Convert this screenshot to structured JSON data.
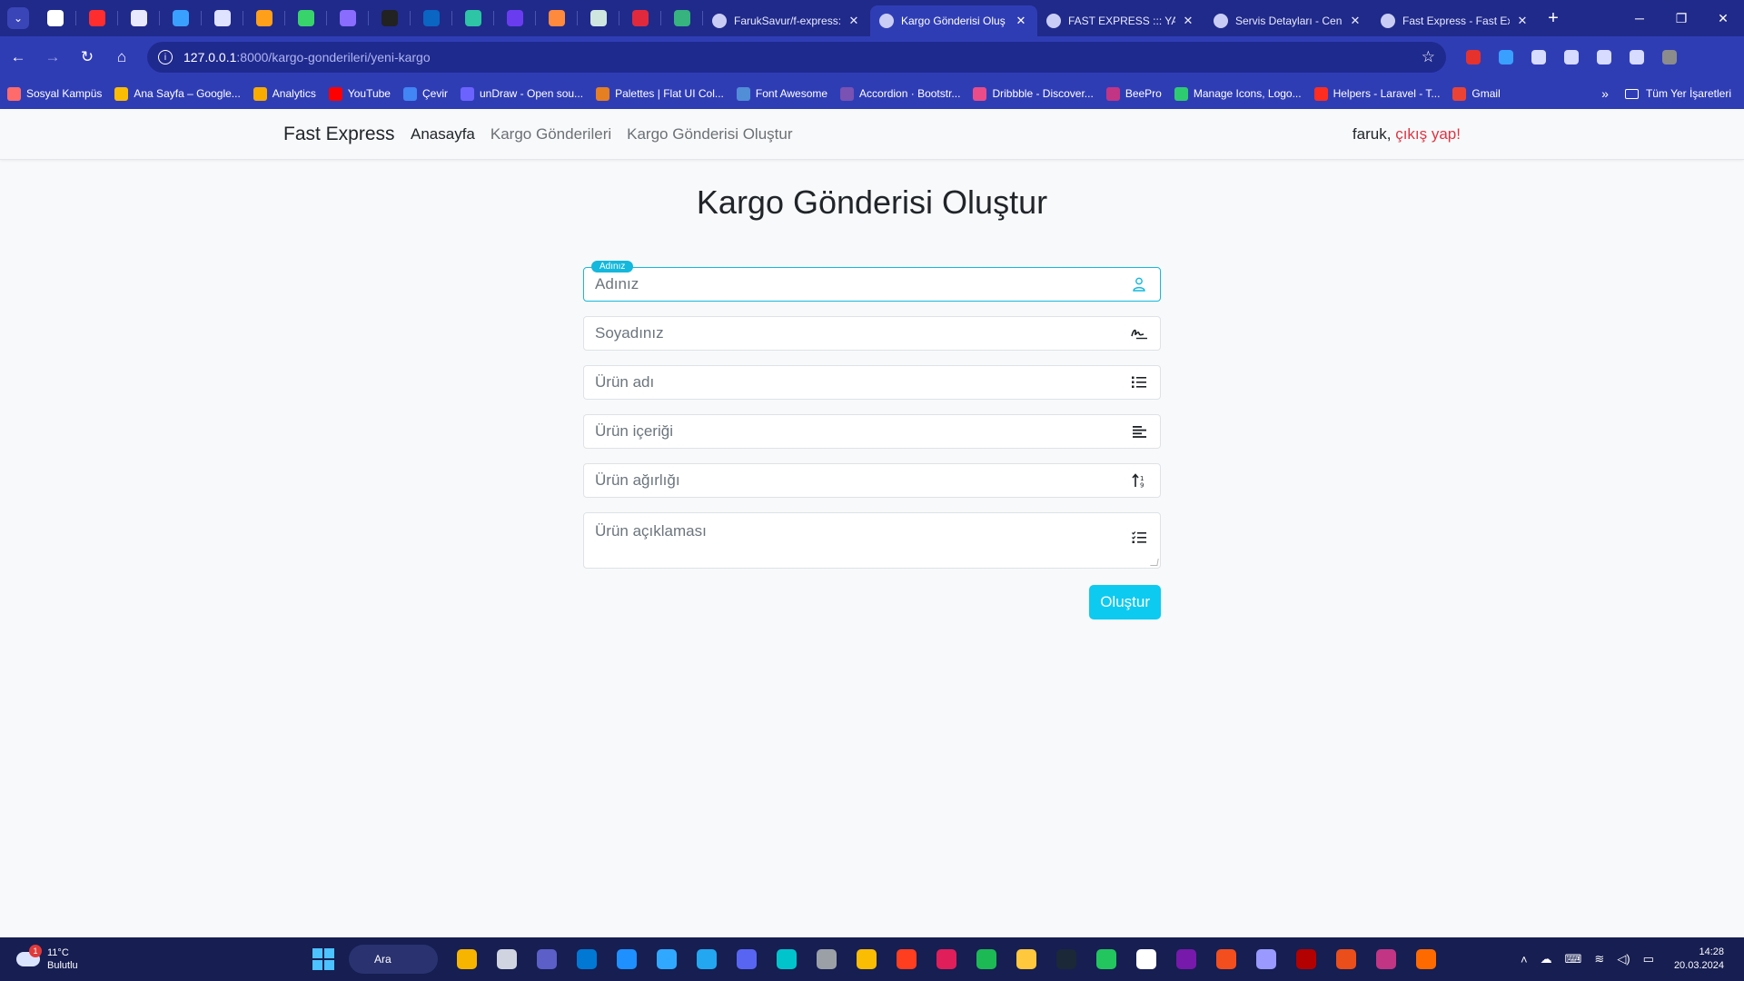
{
  "browser": {
    "tabs": [
      {
        "title": "FarukSavur/f-express:",
        "active": false
      },
      {
        "title": "Kargo Gönderisi Oluş",
        "active": true
      },
      {
        "title": "FAST EXPRESS ::: YAZI",
        "active": false
      },
      {
        "title": "Servis Detayları - Cen",
        "active": false
      },
      {
        "title": "Fast Express - Fast Ex",
        "active": false
      }
    ],
    "pinned_colors": [
      "#ffffff",
      "#ff2d2d",
      "#e8e8ff",
      "#3aa0ff",
      "#dfe3ff",
      "#ff9f1a",
      "#38d36b",
      "#8a6cff",
      "#222222",
      "#0a66c2",
      "#2ec4a6",
      "#6a3cf0",
      "#ff8a3d",
      "#cfe6e0",
      "#e0293d",
      "#36b37e"
    ],
    "url_host": "127.0.0.1",
    "url_path": ":8000/kargo-gonderileri/yeni-kargo",
    "extensions_colors": [
      "#e5322d",
      "#3aa0ff",
      "#d7dbff",
      "#d7dbff",
      "#d7dbff",
      "#d7dbff",
      "#8c8c8c"
    ],
    "bookmarks": [
      {
        "label": "Sosyal Kampüs",
        "color": "#ff6b6b"
      },
      {
        "label": "Ana Sayfa – Google...",
        "color": "#fbbc04"
      },
      {
        "label": "Analytics",
        "color": "#f9ab00"
      },
      {
        "label": "YouTube",
        "color": "#ff0000"
      },
      {
        "label": "Çevir",
        "color": "#4285f4"
      },
      {
        "label": "unDraw - Open sou...",
        "color": "#6c63ff"
      },
      {
        "label": "Palettes | Flat UI Col...",
        "color": "#e67e22"
      },
      {
        "label": "Font Awesome",
        "color": "#528dd7"
      },
      {
        "label": "Accordion · Bootstr...",
        "color": "#7952b3"
      },
      {
        "label": "Dribbble - Discover...",
        "color": "#ea4c89"
      },
      {
        "label": "BeePro",
        "color": "#c13584"
      },
      {
        "label": "Manage Icons, Logo...",
        "color": "#2ecc71"
      },
      {
        "label": "Helpers - Laravel - T...",
        "color": "#ff2d20"
      },
      {
        "label": "Gmail",
        "color": "#ea4335"
      }
    ],
    "bookmarks_folder": "Tüm Yer İşaretleri"
  },
  "site": {
    "brand": "Fast Express",
    "nav": [
      {
        "label": "Anasayfa",
        "current": true
      },
      {
        "label": "Kargo Gönderileri",
        "current": false
      },
      {
        "label": "Kargo Gönderisi Oluştur",
        "current": false
      }
    ],
    "user_name": "faruk,",
    "logout_label": "çıkış yap!"
  },
  "form": {
    "title": "Kargo Gönderisi Oluştur",
    "floating_label": "Adınız",
    "fields": [
      {
        "placeholder": "Adınız",
        "icon": "user-icon"
      },
      {
        "placeholder": "Soyadınız",
        "icon": "signature-icon"
      },
      {
        "placeholder": "Ürün adı",
        "icon": "list-ol-icon"
      },
      {
        "placeholder": "Ürün içeriği",
        "icon": "align-left-icon"
      },
      {
        "placeholder": "Ürün ağırlığı",
        "icon": "sort-numeric-icon"
      },
      {
        "placeholder": "Ürün açıklaması",
        "icon": "list-check-icon"
      }
    ],
    "submit_label": "Oluştur"
  },
  "taskbar": {
    "temperature": "11°C",
    "weather": "Bulutlu",
    "weather_badge": "1",
    "search_label": "Ara",
    "app_colors": [
      "#f7b500",
      "#d0d4e0",
      "#5b5fc7",
      "#0078d4",
      "#1e90ff",
      "#31a8ff",
      "#22a7f0",
      "#5865f2",
      "#00c4cc",
      "#9aa0a6",
      "#fbbc04",
      "#ff3d1f",
      "#e01e5a",
      "#1db954",
      "#ffc83d",
      "#1b2838",
      "#22c55e",
      "#ffffff",
      "#7719aa",
      "#f24e1e",
      "#9999ff",
      "#b30000",
      "#e94e1b",
      "#c13584",
      "#ff6a00"
    ],
    "time": "14:28",
    "date": "20.03.2024"
  },
  "colors": {
    "accent": "#0dcaf0",
    "logout": "#dc3545",
    "browser_frame": "#2f3db5"
  }
}
